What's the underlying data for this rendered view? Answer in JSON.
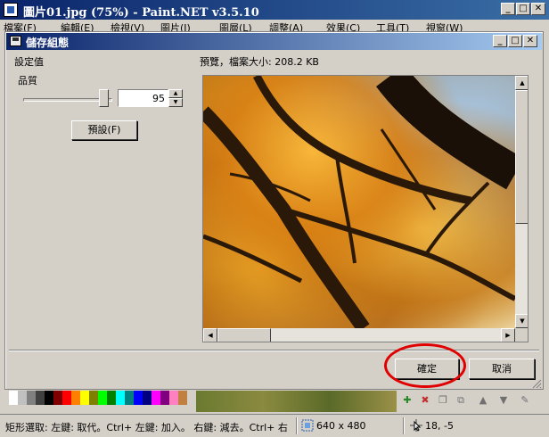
{
  "outer_window": {
    "title": "圖片01.jpg (75%) - Paint.NET v3.5.10",
    "menu": [
      "檔案(F)",
      "編輯(E)",
      "檢視(V)",
      "圖片(I)",
      "圖層(L)",
      "調整(A)",
      "效果(C)",
      "工具(T)",
      "視窗(W)"
    ]
  },
  "dialog": {
    "title": "儲存組態",
    "settings_label": "設定值",
    "quality_label": "品質",
    "quality_value": "95",
    "quality_fraction": 0.95,
    "defaults_button": "預設(F)",
    "preview_label": "預覽，檔案大小: 208.2 KB",
    "ok_button": "確定",
    "cancel_button": "取消"
  },
  "status_bar": {
    "hint": "矩形選取: 左鍵: 取代。Ctrl+ 左鍵: 加入。 右鍵: 減去。Ctrl+ 右",
    "image_size": "640 x 480",
    "cursor_pos": "18, -5"
  },
  "colors": {
    "highlight_ring": "#e00000",
    "title_bar": "#0a246a"
  },
  "palette_colors": [
    "#ffffff",
    "#c0c0c0",
    "#808080",
    "#404040",
    "#000000",
    "#800000",
    "#ff0000",
    "#ff8000",
    "#ffff00",
    "#808000",
    "#00ff00",
    "#008000",
    "#00ffff",
    "#008080",
    "#0000ff",
    "#000080",
    "#ff00ff",
    "#800080",
    "#ff80c0",
    "#c08040"
  ]
}
